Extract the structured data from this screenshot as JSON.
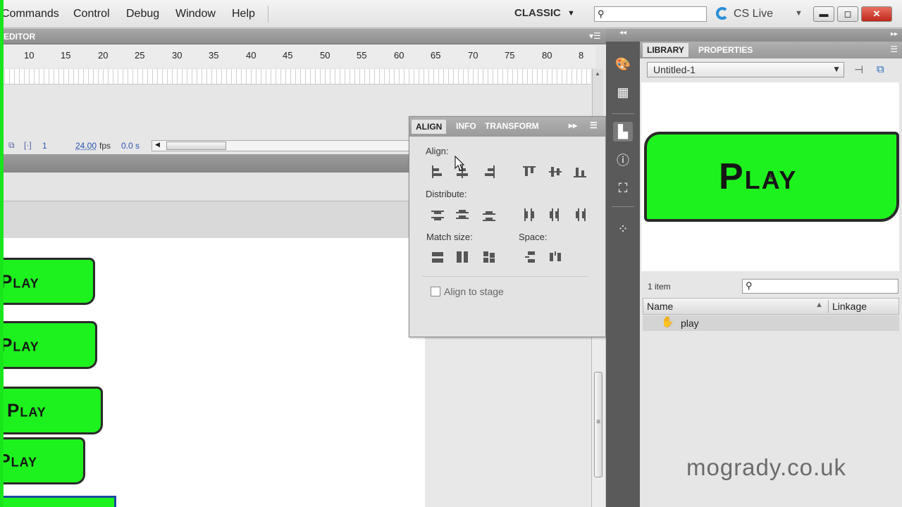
{
  "menu": [
    "Commands",
    "Control",
    "Debug",
    "Window",
    "Help"
  ],
  "workspace": "CLASSIC",
  "cslive": "CS Live",
  "timeline": {
    "title": "EDITOR",
    "ruler": [
      "10",
      "15",
      "20",
      "25",
      "30",
      "35",
      "40",
      "45",
      "50",
      "55",
      "60",
      "65",
      "70",
      "75",
      "80",
      "8"
    ],
    "frame": "1",
    "fps": "24.00",
    "fps_unit": "fps",
    "time": "0.0 s"
  },
  "stage": {
    "buttons": [
      "Play",
      "Play",
      "Play",
      "Play"
    ]
  },
  "align_panel": {
    "tabs": [
      "ALIGN",
      "INFO",
      "TRANSFORM"
    ],
    "align_label": "Align:",
    "distribute_label": "Distribute:",
    "match_size_label": "Match size:",
    "space_label": "Space:",
    "align_to_stage": "Align to stage"
  },
  "library": {
    "tabs": [
      "LIBRARY",
      "PROPERTIES"
    ],
    "document": "Untitled-1",
    "preview_label": "Play",
    "item_count": "1 item",
    "col_name": "Name",
    "col_linkage": "Linkage",
    "items": [
      "play"
    ]
  },
  "watermark": "mogrady.co.uk",
  "colors": {
    "button_green": "#1ef21e",
    "accent_blue": "#2a8fd6"
  }
}
